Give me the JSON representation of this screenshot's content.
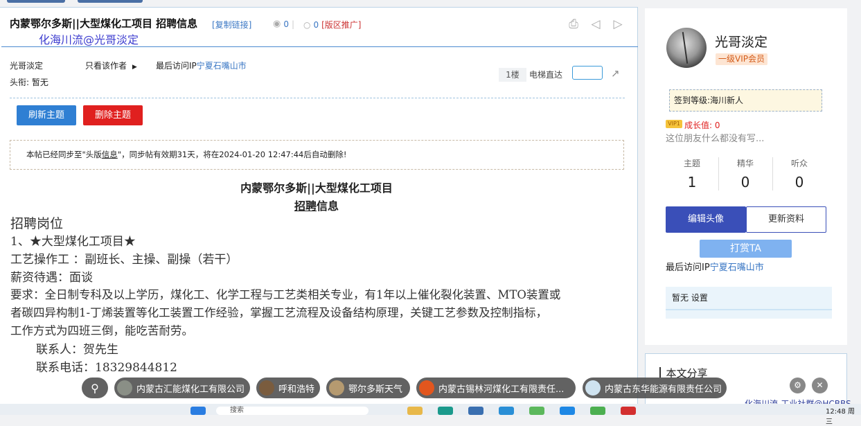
{
  "post": {
    "title": "内蒙鄂尔多斯||大型煤化工项目 招聘信息",
    "copy_link": "[复制链接]",
    "views": "0",
    "replies": "0",
    "promote": "[版区推广]",
    "watermark": "化海川流@光哥淡定",
    "author": "光哥淡定",
    "only_author": "只看该作者",
    "last_ip_label": "最后访问IP",
    "last_ip": "宁夏石嘴山市",
    "head_title": "头衔:  暂无",
    "floor": "1楼",
    "elevator": "电梯直达",
    "refresh_button": "刷新主题",
    "delete_button": "删除主题",
    "notice_pre": "本帖已经同步至\"头版",
    "notice_link": "信息",
    "notice_post": "\"，同步帖有效期31天，将在2024-01-20 12:47:44后自动删除!",
    "heading1": "内蒙鄂尔多斯||大型煤化工项目",
    "heading2_u": "招聘",
    "heading2_rest": "信息",
    "section": "招聘岗位",
    "line1": "1、★大型煤化工项目★",
    "line2": "工艺操作工 ：副班长、主操、副操（若干）",
    "line3": "薪资待遇：面谈",
    "line4": "要求：全日制专科及以上学历，煤化工、化学工程与工艺类相关专业，有1年以上催化裂化装置、MTO装置或",
    "line5": "者碳四异构制1-丁烯装置等化工装置工作经验，掌握工艺流程及设备结构原理，关键工艺参数及控制指标，",
    "line6": "工作方式为四班三倒，能吃苦耐劳。",
    "contact": "联系人：贺先生",
    "phone": "联系电话：18329844812"
  },
  "profile": {
    "username": "光哥淡定",
    "vip_level": "一级VIP会员",
    "sign_level": "签到等级:海川新人",
    "vip_badge": "VIP1",
    "growth": "成长值: 0",
    "bio": "这位朋友什么都没有写...",
    "stats": [
      {
        "label": "主题",
        "value": "1"
      },
      {
        "label": "精华",
        "value": "0"
      },
      {
        "label": "听众",
        "value": "0"
      }
    ],
    "edit_avatar": "编辑头像",
    "update_info": "更新资料",
    "reward": "打赏TA",
    "last_ip_label": "最后访问IP",
    "last_ip": "宁夏石嘴山市",
    "title_row": "暂无  设置",
    "share_title": "本文分享"
  },
  "chips": [
    {
      "label": "内蒙古汇能煤化工有限公司",
      "thumb": "#8a8f86"
    },
    {
      "label": "呼和浩特",
      "thumb": "#7a5c3e"
    },
    {
      "label": "鄂尔多斯天气",
      "thumb": "#b59a70"
    },
    {
      "label": "内蒙古锡林河煤化工有限责任...",
      "thumb": "#e2561e"
    },
    {
      "label": "内蒙古东华能源有限责任公司",
      "thumb": "#cfe3f0"
    }
  ],
  "footer_watermark": "化海川流-工业社群@HCBBS",
  "taskbar": {
    "search_placeholder": "搜索",
    "clock": "12:48 周三"
  }
}
